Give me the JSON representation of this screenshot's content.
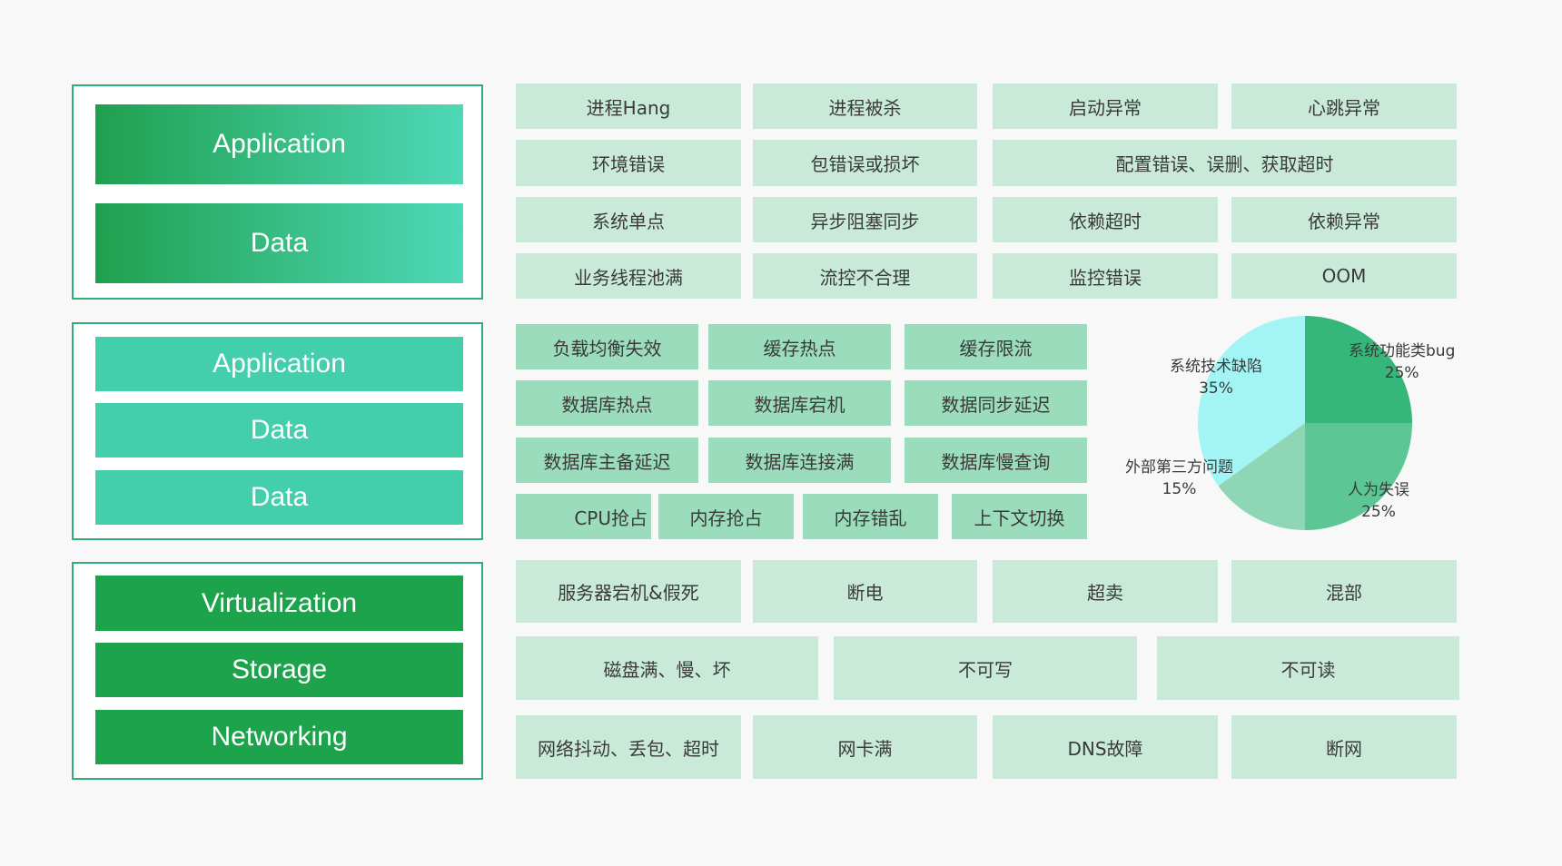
{
  "layers": {
    "app_group": [
      "Application",
      "Data"
    ],
    "middleware_group": [
      "Application",
      "Data",
      "Data"
    ],
    "infra_group": [
      "Virtualization",
      "Storage",
      "Networking"
    ]
  },
  "app_faults": [
    [
      "进程Hang",
      "进程被杀",
      "启动异常",
      "心跳异常"
    ],
    [
      "环境错误",
      "包错误或损坏",
      "配置错误、误删、获取超时"
    ],
    [
      "系统单点",
      "异步阻塞同步",
      "依赖超时",
      "依赖异常"
    ],
    [
      "业务线程池满",
      "流控不合理",
      "监控错误",
      "OOM"
    ]
  ],
  "middleware_faults": [
    [
      "负载均衡失效",
      "缓存热点",
      "缓存限流"
    ],
    [
      "数据库热点",
      "数据库宕机",
      "数据同步延迟"
    ],
    [
      "数据库主备延迟",
      "数据库连接满",
      "数据库慢查询"
    ],
    [
      "CPU抢占",
      "内存抢占",
      "内存错乱",
      "上下文切换"
    ]
  ],
  "infra_faults": [
    [
      "服务器宕机&假死",
      "断电",
      "超卖",
      "混部"
    ],
    [
      "磁盘满、慢、坏",
      "不可写",
      "不可读"
    ],
    [
      "网络抖动、丢包、超时",
      "网卡满",
      "DNS故障",
      "断网"
    ]
  ],
  "chart_data": {
    "type": "pie",
    "slices": [
      {
        "label": "系统功能类bug",
        "pct_text": "25%",
        "value": 25,
        "color": "#35b77a"
      },
      {
        "label": "人为失误",
        "pct_text": "25%",
        "value": 25,
        "color": "#5cc794"
      },
      {
        "label": "外部第三方问题",
        "pct_text": "15%",
        "value": 15,
        "color": "#8fd6b6"
      },
      {
        "label": "系统技术缺陷",
        "pct_text": "35%",
        "value": 35,
        "color": "#a3f5f5"
      }
    ]
  }
}
